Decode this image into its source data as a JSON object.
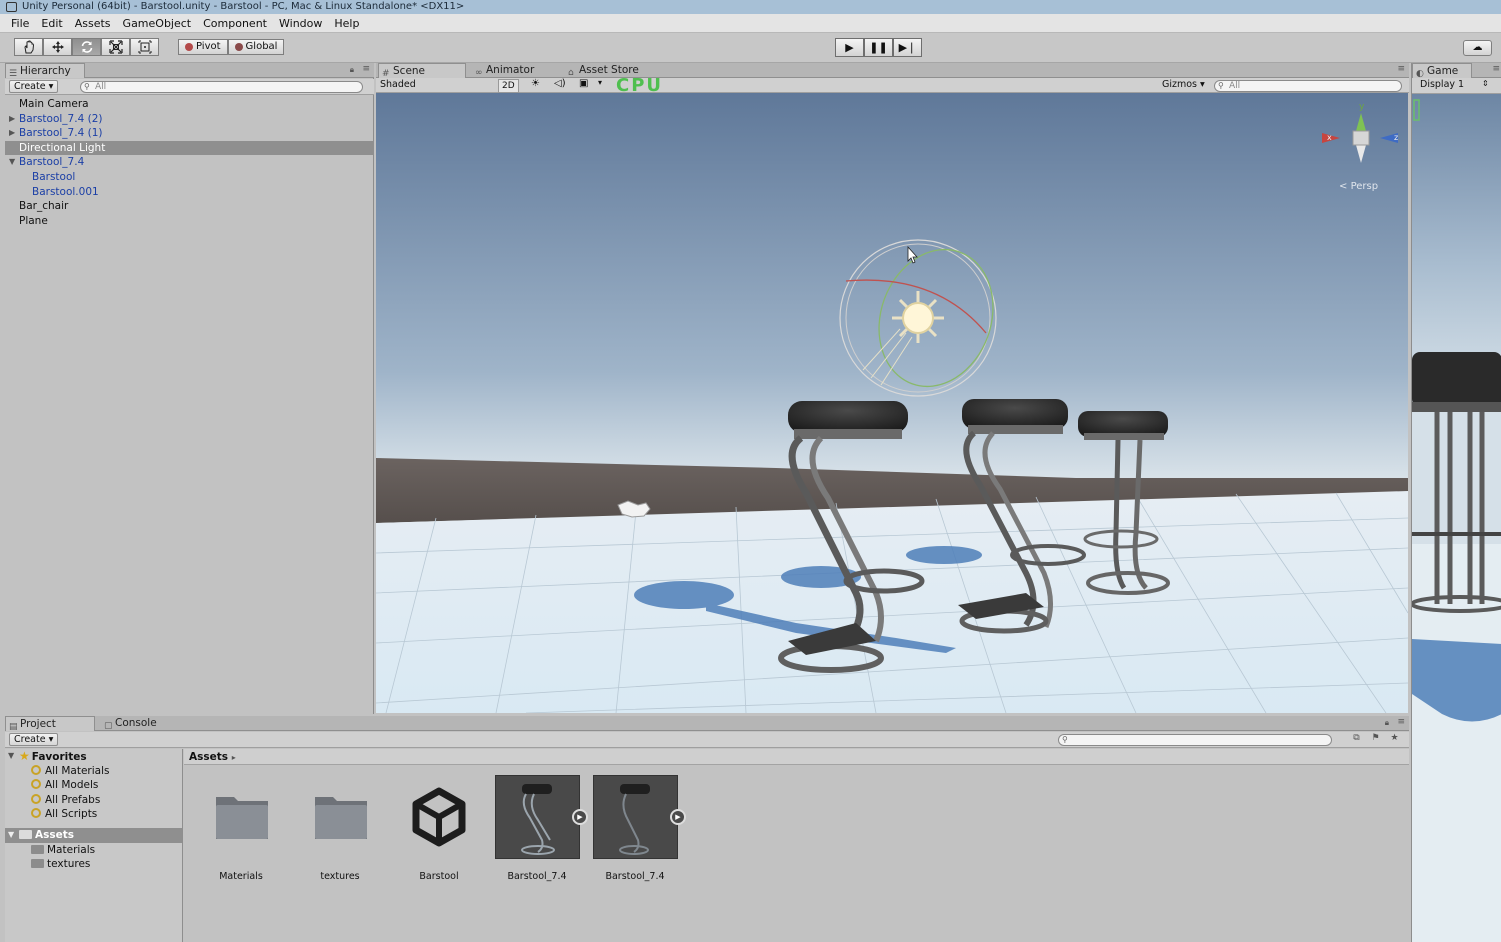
{
  "window": {
    "title": "Unity Personal (64bit) - Barstool.unity - Barstool - PC, Mac & Linux Standalone* <DX11>"
  },
  "menu": [
    "File",
    "Edit",
    "Assets",
    "GameObject",
    "Component",
    "Window",
    "Help"
  ],
  "toolbar": {
    "tools": [
      "hand-icon",
      "move-icon",
      "rotate-icon",
      "scale-icon",
      "rect-icon"
    ],
    "pivot_label": "Pivot",
    "global_label": "Global",
    "play_icons": [
      "play-icon",
      "pause-icon",
      "step-icon"
    ]
  },
  "hierarchy": {
    "tab": "Hierarchy",
    "create_label": "Create",
    "search_placeholder": "All",
    "items": [
      {
        "label": "Main Camera",
        "indent": 0,
        "prefab": false,
        "arrow": ""
      },
      {
        "label": "Barstool_7.4 (2)",
        "indent": 0,
        "prefab": true,
        "arrow": "▶"
      },
      {
        "label": "Barstool_7.4 (1)",
        "indent": 0,
        "prefab": true,
        "arrow": "▶"
      },
      {
        "label": "Directional Light",
        "indent": 0,
        "prefab": false,
        "arrow": "",
        "selected": true
      },
      {
        "label": "Barstool_7.4",
        "indent": 0,
        "prefab": true,
        "arrow": "▼"
      },
      {
        "label": "Barstool",
        "indent": 1,
        "prefab": true,
        "arrow": ""
      },
      {
        "label": "Barstool.001",
        "indent": 1,
        "prefab": true,
        "arrow": ""
      },
      {
        "label": "Bar_chair",
        "indent": 0,
        "prefab": false,
        "arrow": ""
      },
      {
        "label": "Plane",
        "indent": 0,
        "prefab": false,
        "arrow": ""
      }
    ]
  },
  "scene": {
    "tabs": [
      "Scene",
      "Animator",
      "Asset Store"
    ],
    "shading": "Shaded",
    "mode_2d": "2D",
    "gizmos_label": "Gizmos",
    "search_placeholder": "All",
    "persp_label": "Persp",
    "axis_x": "x",
    "axis_y": "y",
    "axis_z": "z",
    "overlay_text": "CPU"
  },
  "game": {
    "tab": "Game",
    "display": "Display 1"
  },
  "project": {
    "tabs": [
      "Project",
      "Console"
    ],
    "create_label": "Create",
    "favorites_label": "Favorites",
    "favorites": [
      "All Materials",
      "All Models",
      "All Prefabs",
      "All Scripts"
    ],
    "assets_label": "Assets",
    "asset_folders": [
      "Materials",
      "textures"
    ],
    "breadcrumb": "Assets",
    "assets": [
      {
        "label": "Materials",
        "kind": "folder"
      },
      {
        "label": "textures",
        "kind": "folder"
      },
      {
        "label": "Barstool",
        "kind": "unity"
      },
      {
        "label": "Barstool_7.4",
        "kind": "model"
      },
      {
        "label": "Barstool_7.4",
        "kind": "model"
      }
    ]
  }
}
